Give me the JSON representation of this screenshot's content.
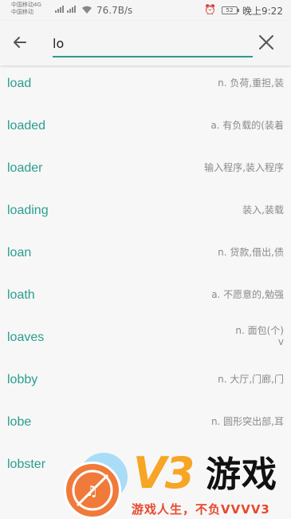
{
  "status_bar": {
    "carrier_1": "中国移动4G",
    "carrier_2": "中国移动",
    "network": "4G",
    "speed": "76.7B/s",
    "battery": "52",
    "time": "晚上9:22"
  },
  "search": {
    "query": "lo",
    "accent_color": "#2a9d8f"
  },
  "results": [
    {
      "word": "load",
      "definition": "n. 负荷,重担,装"
    },
    {
      "word": "loaded",
      "definition": "a. 有负载的(装着"
    },
    {
      "word": "loader",
      "definition": "输入程序,装入程序"
    },
    {
      "word": "loading",
      "definition": "装入,装载"
    },
    {
      "word": "loan",
      "definition": "n. 贷款,借出,债"
    },
    {
      "word": "loath",
      "definition": "a. 不愿意的,勉强"
    },
    {
      "word": "loaves",
      "definition": "n. 面包(个)",
      "definition_line2": "v"
    },
    {
      "word": "lobby",
      "definition": "n. 大厅,门廊,门"
    },
    {
      "word": "lobe",
      "definition": "n. 圆形突出部,耳"
    },
    {
      "word": "lobster",
      "definition": ""
    }
  ],
  "watermark": {
    "brand": "V3",
    "brand_cn": "游戏",
    "slogan": "游戏人生，不负VVVV3"
  }
}
